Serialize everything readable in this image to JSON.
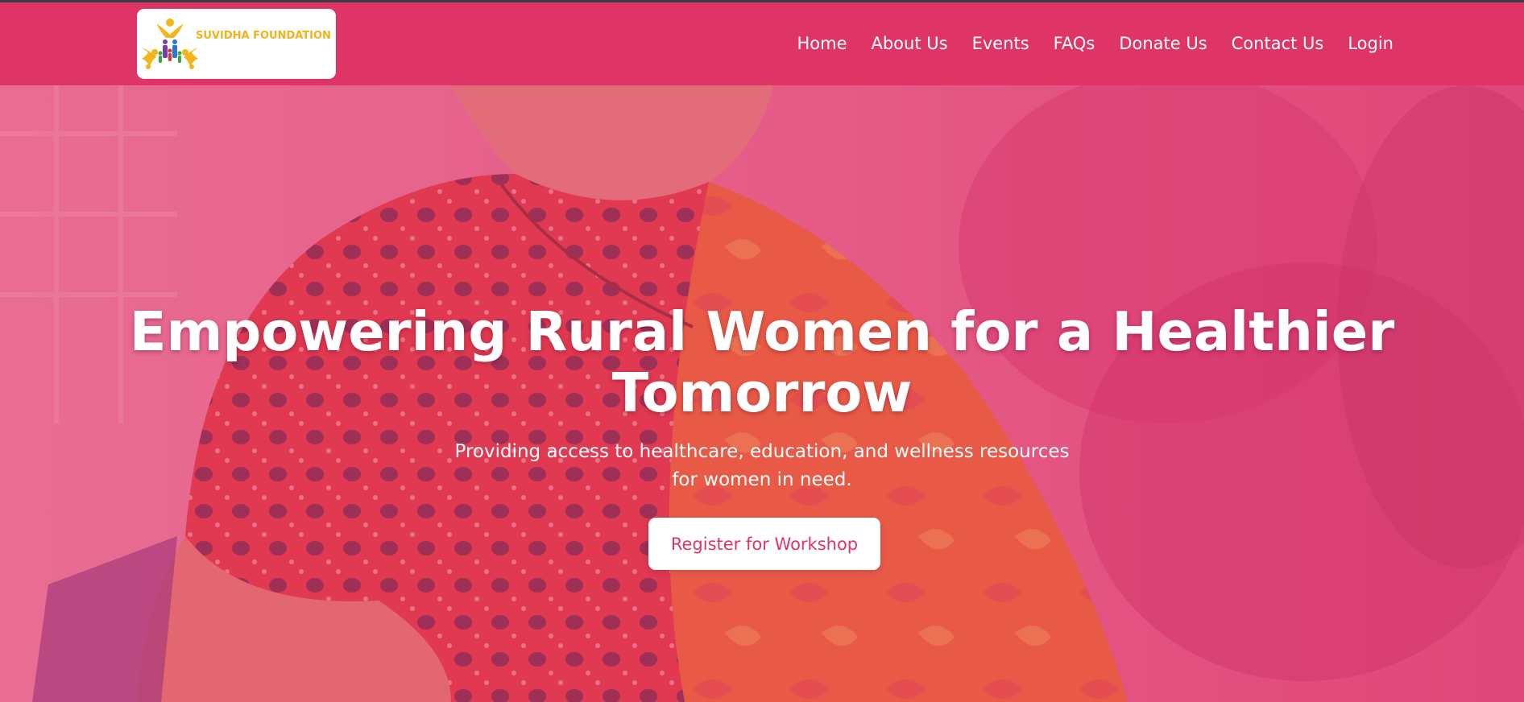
{
  "brand": {
    "name": "SUVIDHA FOUNDATION",
    "logo_icon": "people-star-logo-icon",
    "primary_color": "#de3566",
    "logo_text_color": "#f2b21b"
  },
  "nav": {
    "items": [
      {
        "label": "Home"
      },
      {
        "label": "About Us"
      },
      {
        "label": "Events"
      },
      {
        "label": "FAQs"
      },
      {
        "label": "Donate Us"
      },
      {
        "label": "Contact Us"
      },
      {
        "label": "Login"
      }
    ]
  },
  "hero": {
    "title": "Empowering Rural Women for a Healthier Tomorrow",
    "subtitle": "Providing access to healthcare, education, and wellness resources for women in need.",
    "cta_label": "Register for Workshop"
  }
}
